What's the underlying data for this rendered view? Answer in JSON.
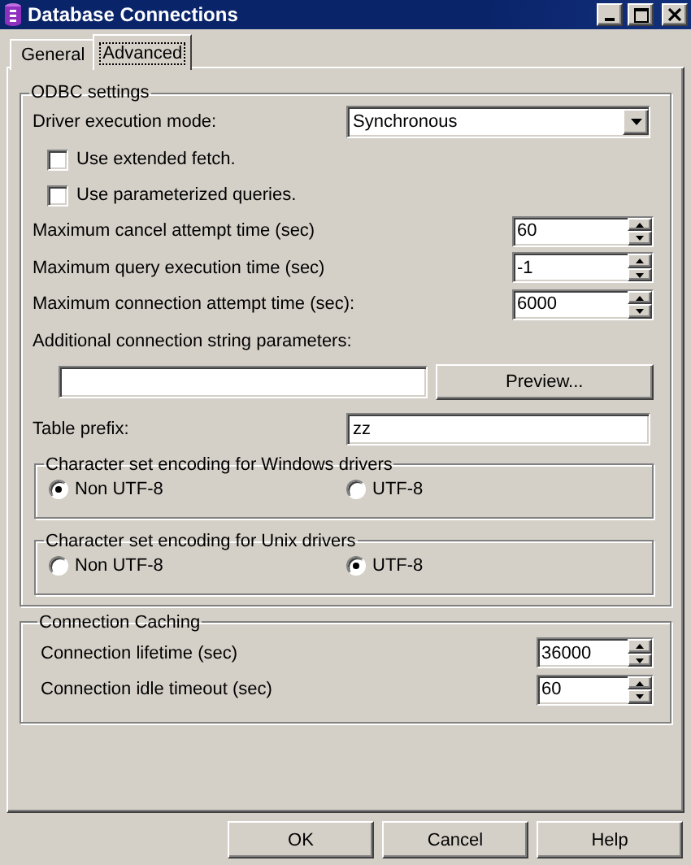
{
  "window": {
    "title": "Database Connections"
  },
  "tabs": [
    {
      "label": "General",
      "selected": false
    },
    {
      "label": "Advanced",
      "selected": true
    }
  ],
  "odbc_settings": {
    "title": "ODBC settings",
    "driver_execution_mode": {
      "label": "Driver execution mode:",
      "value": "Synchronous"
    },
    "checkboxes": [
      {
        "label": "Use extended fetch.",
        "checked": false
      },
      {
        "label": "Use parameterized queries.",
        "checked": false
      }
    ],
    "spinners": [
      {
        "label": "Maximum cancel attempt time (sec)",
        "value": "60"
      },
      {
        "label": "Maximum query execution time (sec)",
        "value": "-1"
      },
      {
        "label": "Maximum connection attempt time (sec):",
        "value": "6000"
      }
    ],
    "connection_string": {
      "label": "Additional connection string parameters:",
      "button": "Preview..."
    },
    "table_prefix": {
      "label": "Table prefix:",
      "value": "zz"
    },
    "encodings": [
      {
        "title": "Character set encoding for Windows drivers",
        "options": [
          {
            "label": "Non UTF-8",
            "selected": true
          },
          {
            "label": "UTF-8",
            "selected": false
          }
        ]
      },
      {
        "title": "Character set encoding for Unix drivers",
        "options": [
          {
            "label": "Non UTF-8",
            "selected": false
          },
          {
            "label": "UTF-8",
            "selected": true
          }
        ]
      }
    ]
  },
  "connection_caching": {
    "title": "Connection Caching",
    "spinners": [
      {
        "label": "Connection lifetime (sec)",
        "value": "36000"
      },
      {
        "label": "Connection idle timeout (sec)",
        "value": "60"
      }
    ]
  },
  "buttons": [
    "OK",
    "Cancel",
    "Help"
  ]
}
